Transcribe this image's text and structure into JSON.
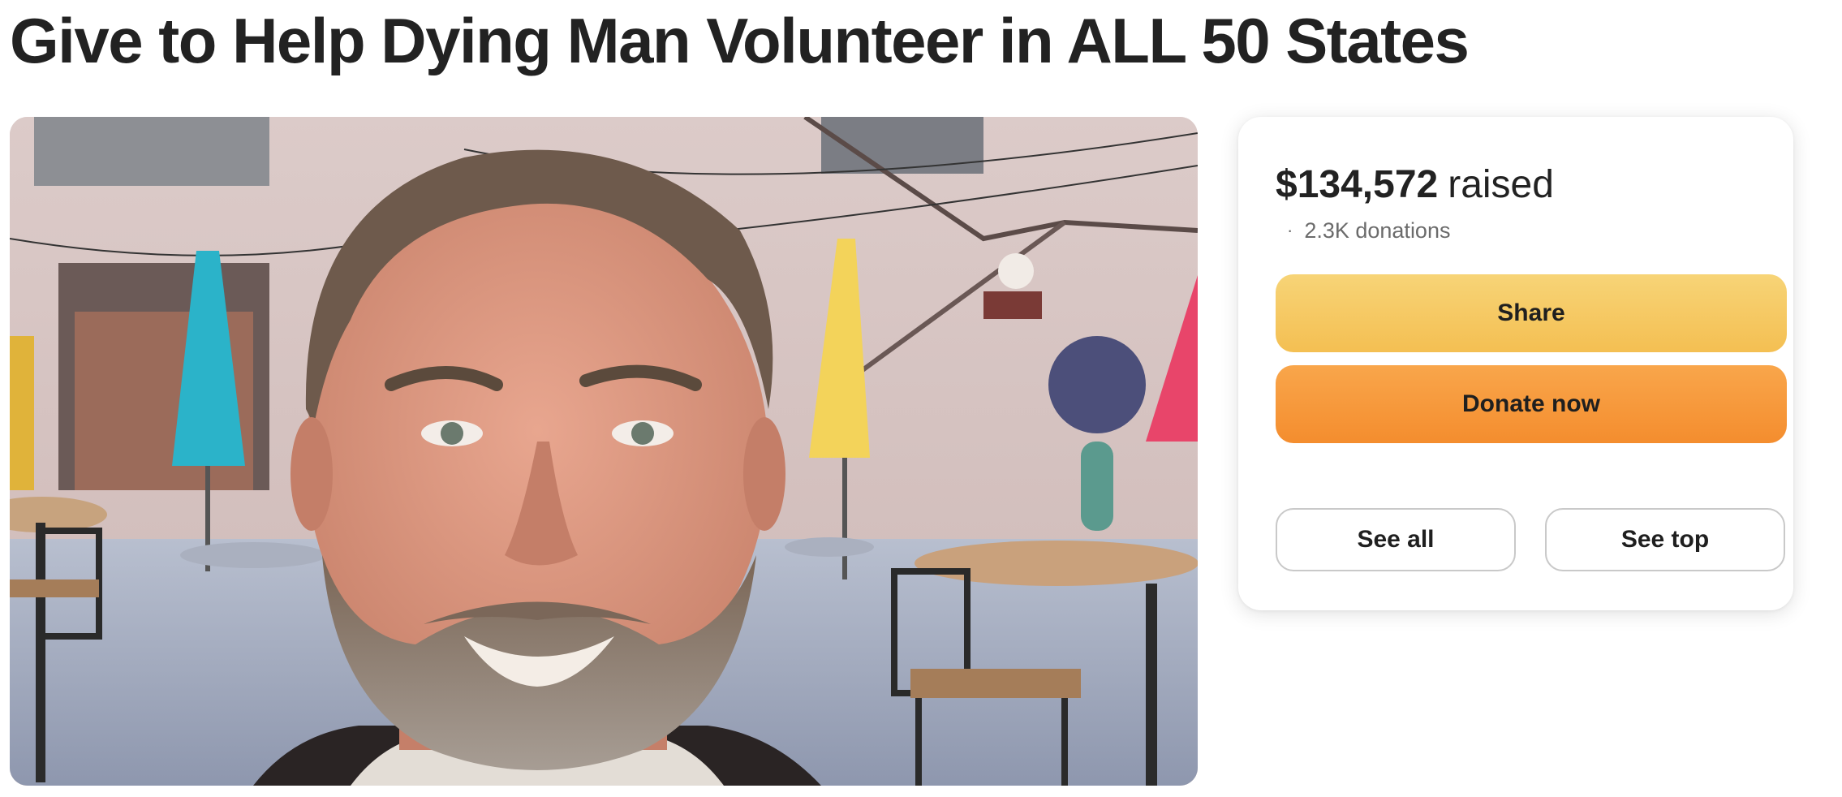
{
  "campaign": {
    "title": "Give to Help Dying Man Volunteer in ALL 50 States"
  },
  "photo": {
    "description_icon": "campaign-photo"
  },
  "donation_card": {
    "amount": "$134,572",
    "raised_label": "raised",
    "dot": "·",
    "donations_count": "2.3K donations",
    "share_label": "Share",
    "donate_label": "Donate now",
    "see_all_label": "See all",
    "see_top_label": "See top"
  },
  "colors": {
    "share_button": "#f5c862",
    "donate_button": "#f6993a",
    "outline_border": "#c9c9c9"
  }
}
